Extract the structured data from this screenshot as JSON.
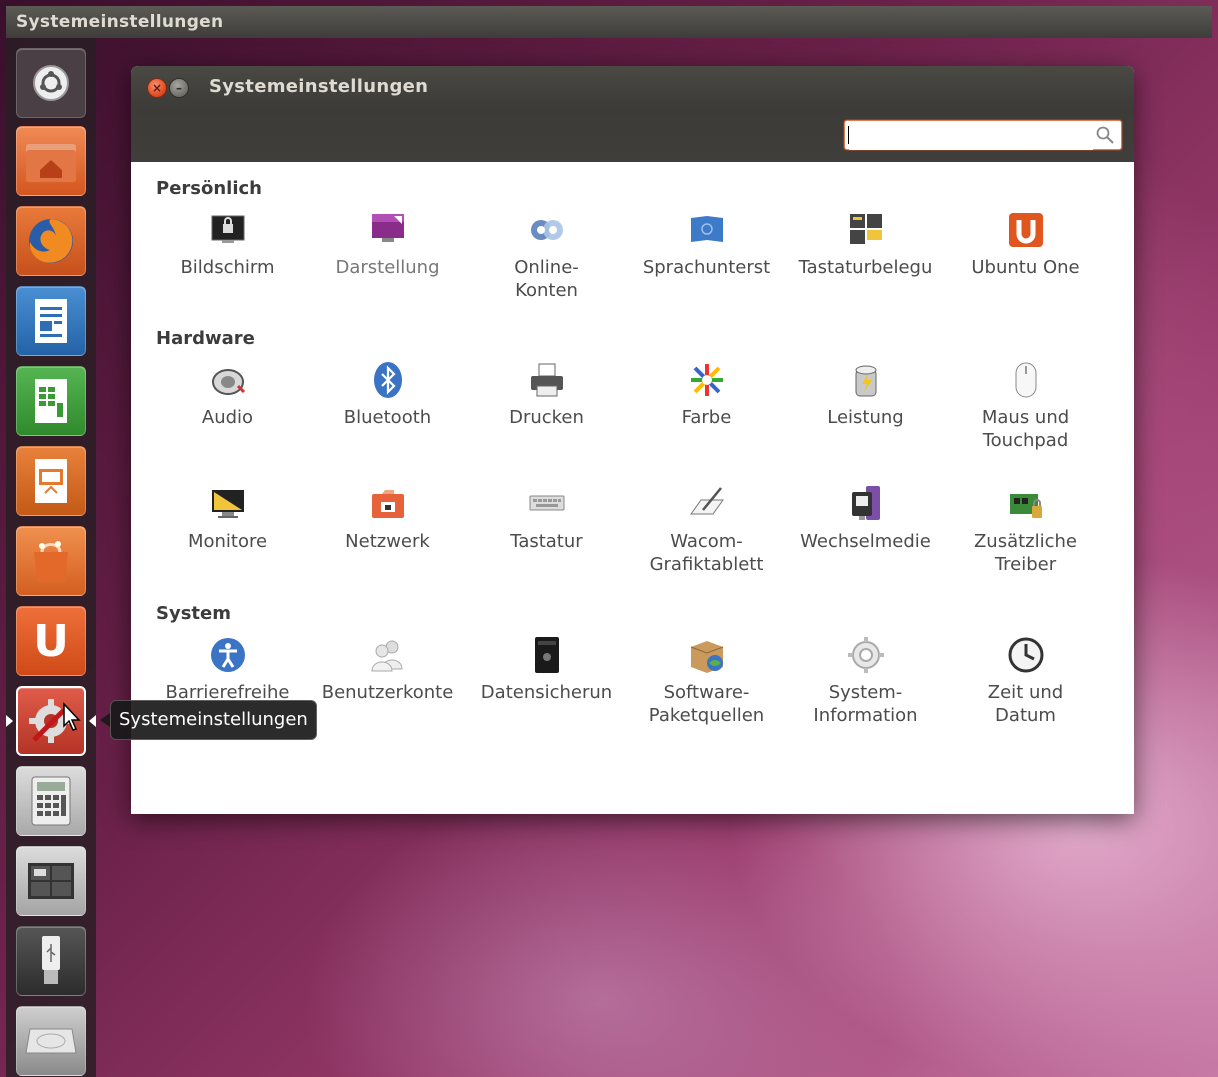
{
  "top_panel": {
    "title": "Systemeinstellungen"
  },
  "window": {
    "title": "Systemeinstellungen",
    "search": {
      "value": "",
      "placeholder": ""
    }
  },
  "tooltip": "Systemeinstellungen",
  "launcher": {
    "items": [
      {
        "name": "Dash",
        "icon": "ubuntu-logo-icon"
      },
      {
        "name": "Persönlicher Ordner",
        "icon": "home-folder-icon"
      },
      {
        "name": "Firefox",
        "icon": "firefox-icon"
      },
      {
        "name": "LibreOffice Writer",
        "icon": "writer-icon"
      },
      {
        "name": "LibreOffice Calc",
        "icon": "calc-icon"
      },
      {
        "name": "LibreOffice Impress",
        "icon": "impress-icon"
      },
      {
        "name": "Software-Center",
        "icon": "software-center-icon"
      },
      {
        "name": "Ubuntu One",
        "icon": "ubuntu-one-icon"
      },
      {
        "name": "Systemeinstellungen",
        "icon": "system-settings-icon"
      },
      {
        "name": "Rechner",
        "icon": "calculator-icon"
      },
      {
        "name": "Arbeitsflächen",
        "icon": "workspace-switcher-icon"
      },
      {
        "name": "USB-Stick",
        "icon": "usb-drive-icon"
      },
      {
        "name": "Laufwerk",
        "icon": "hard-drive-icon"
      }
    ]
  },
  "sections": [
    {
      "title": "Persönlich",
      "items": [
        {
          "label": "Bildschirm",
          "icon": "screen-lock-icon"
        },
        {
          "label": "Darstellung",
          "icon": "appearance-icon"
        },
        {
          "label": "Online-\nKonten",
          "icon": "online-accounts-icon"
        },
        {
          "label": "Sprachunterst",
          "icon": "language-support-icon"
        },
        {
          "label": "Tastaturbelegu",
          "icon": "keyboard-layout-icon"
        },
        {
          "label": "Ubuntu One",
          "icon": "ubuntu-one-icon"
        }
      ]
    },
    {
      "title": "Hardware",
      "items": [
        {
          "label": "Audio",
          "icon": "audio-icon"
        },
        {
          "label": "Bluetooth",
          "icon": "bluetooth-icon"
        },
        {
          "label": "Drucken",
          "icon": "printer-icon"
        },
        {
          "label": "Farbe",
          "icon": "color-icon"
        },
        {
          "label": "Leistung",
          "icon": "power-icon"
        },
        {
          "label": "Maus und\nTouchpad",
          "icon": "mouse-icon"
        },
        {
          "label": "Monitore",
          "icon": "monitor-icon"
        },
        {
          "label": "Netzwerk",
          "icon": "network-icon"
        },
        {
          "label": "Tastatur",
          "icon": "keyboard-icon"
        },
        {
          "label": "Wacom-\nGrafiktablett",
          "icon": "wacom-tablet-icon"
        },
        {
          "label": "Wechselmedie",
          "icon": "removable-media-icon"
        },
        {
          "label": "Zusätzliche\nTreiber",
          "icon": "additional-drivers-icon"
        }
      ]
    },
    {
      "title": "System",
      "items": [
        {
          "label": "Barrierefreihe",
          "icon": "accessibility-icon"
        },
        {
          "label": "Benutzerkonte",
          "icon": "user-accounts-icon"
        },
        {
          "label": "Datensicherun",
          "icon": "backup-icon"
        },
        {
          "label": "Software-\nPaketquellen",
          "icon": "software-sources-icon"
        },
        {
          "label": "System-\nInformation",
          "icon": "system-info-icon"
        },
        {
          "label": "Zeit und\nDatum",
          "icon": "time-date-icon"
        }
      ]
    }
  ]
}
